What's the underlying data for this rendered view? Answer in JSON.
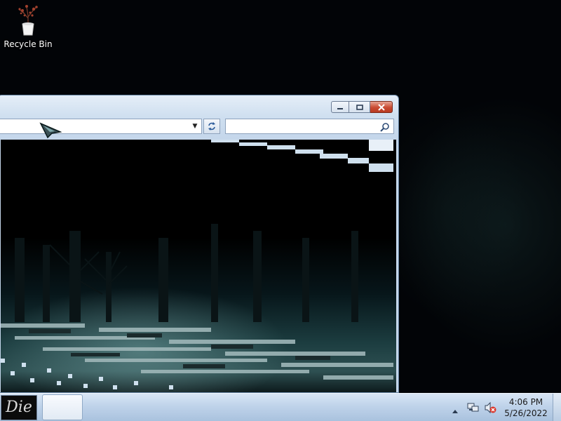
{
  "desktop": {
    "icons": [
      {
        "label": "Recycle Bin",
        "icon": "recycle-bin-plant-icon"
      }
    ]
  },
  "window": {
    "address_value": "",
    "search_placeholder": "",
    "caption_buttons": [
      "minimize",
      "maximize",
      "close"
    ]
  },
  "taskbar": {
    "start_label": "Die",
    "clock": {
      "time": "4:06 PM",
      "date": "5/26/2022"
    },
    "tray_icons": [
      "show-hidden-icons-arrow",
      "network-icon",
      "volume-muted-icon"
    ]
  },
  "colors": {
    "close_button": "#c94b32",
    "taskbar": "#bfd3ea",
    "window_frame": "#cfdff0"
  }
}
